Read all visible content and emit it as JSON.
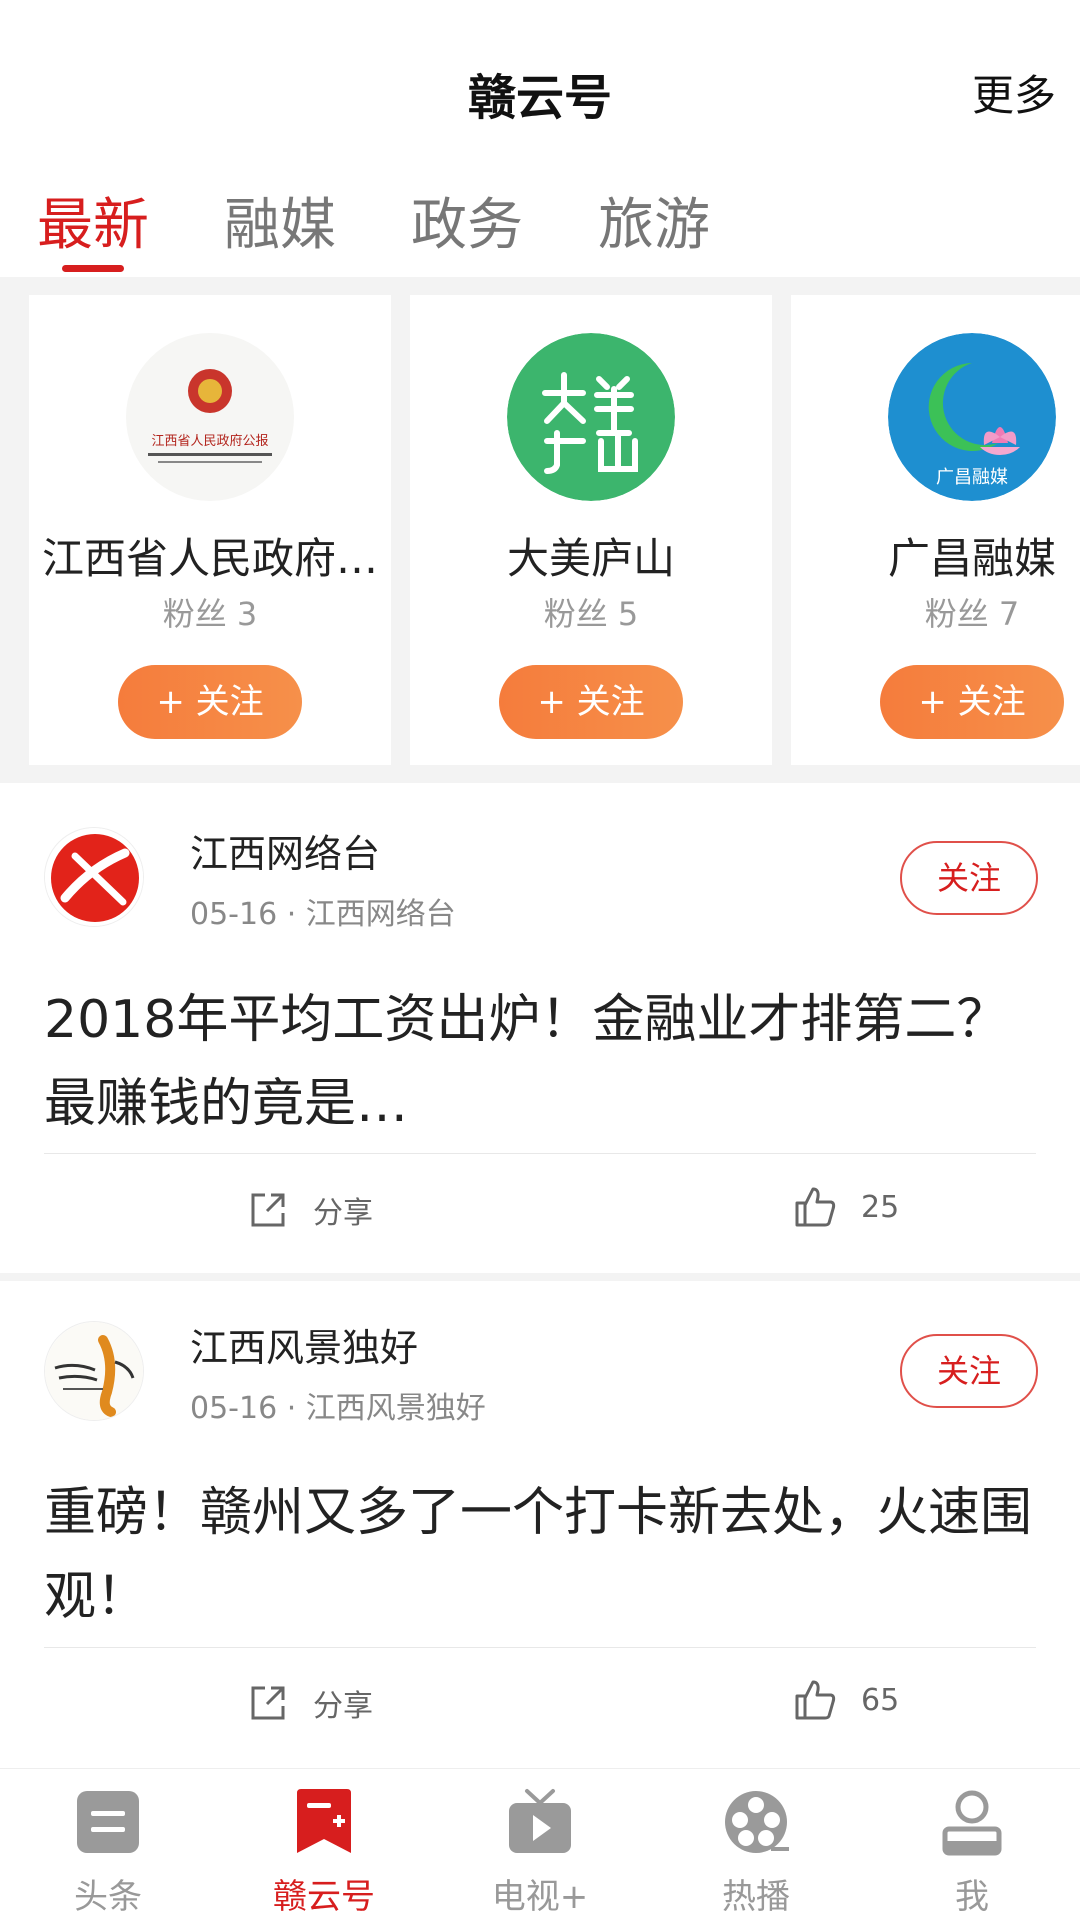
{
  "header": {
    "title": "赣云号",
    "more": "更多"
  },
  "tabs": [
    {
      "label": "最新",
      "active": true
    },
    {
      "label": "融媒",
      "active": false
    },
    {
      "label": "政务",
      "active": false
    },
    {
      "label": "旅游",
      "active": false
    }
  ],
  "recommend": [
    {
      "name": "江西省人民政府…",
      "fans": "粉丝 3",
      "follow": "+ 关注",
      "avatar_text": "江西省人民政府公报"
    },
    {
      "name": "大美庐山",
      "fans": "粉丝 5",
      "follow": "+ 关注"
    },
    {
      "name": "广昌融媒",
      "fans": "粉丝 7",
      "follow": "+ 关注",
      "avatar_text": "广昌融媒"
    }
  ],
  "feed": [
    {
      "author": "江西网络台",
      "meta": "05-16 · 江西网络台",
      "follow": "关注",
      "title": "2018年平均工资出炉！金融业才排第二？最赚钱的竟是…",
      "share": "分享",
      "likes": "25"
    },
    {
      "author": "江西风景独好",
      "meta": "05-16 · 江西风景独好",
      "follow": "关注",
      "title": "重磅！赣州又多了一个打卡新去处，火速围观！",
      "share": "分享",
      "likes": "65"
    }
  ],
  "nav": [
    {
      "label": "头条",
      "icon": "headline-icon",
      "active": false
    },
    {
      "label": "赣云号",
      "icon": "bookmark-add-icon",
      "active": true
    },
    {
      "label": "电视+",
      "icon": "tv-icon",
      "active": false
    },
    {
      "label": "热播",
      "icon": "film-reel-icon",
      "active": false
    },
    {
      "label": "我",
      "icon": "user-icon",
      "active": false
    }
  ],
  "colors": {
    "accent": "#d71e1e",
    "follow_orange": "#f57c3c",
    "inactive": "#999999"
  }
}
